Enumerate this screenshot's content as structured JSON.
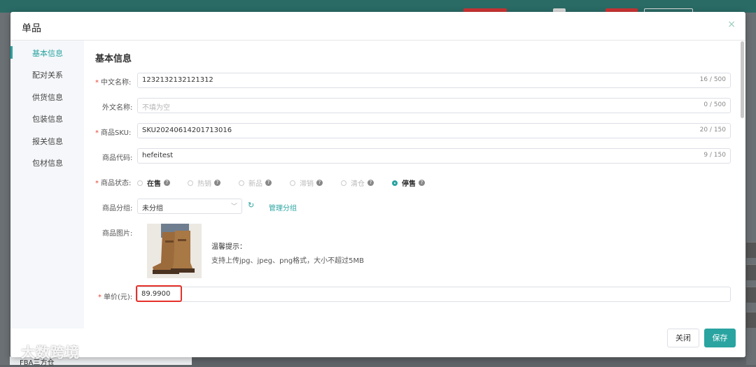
{
  "dialog": {
    "title": "单品",
    "close_icon": "×"
  },
  "sidebar": {
    "items": [
      {
        "label": "基本信息",
        "active": true
      },
      {
        "label": "配对关系",
        "active": false
      },
      {
        "label": "供货信息",
        "active": false
      },
      {
        "label": "包装信息",
        "active": false
      },
      {
        "label": "报关信息",
        "active": false
      },
      {
        "label": "包材信息",
        "active": false
      }
    ]
  },
  "section": {
    "title": "基本信息"
  },
  "form": {
    "required_mark": "*",
    "cn_name": {
      "label": "中文名称:",
      "value": "1232132132121312",
      "count": "16 / 500"
    },
    "foreign_name": {
      "label": "外文名称:",
      "placeholder": "不填为空",
      "count": "0 / 500"
    },
    "sku": {
      "label": "商品SKU:",
      "value": "SKU20240614201713016",
      "count": "20 / 150"
    },
    "code": {
      "label": "商品代码:",
      "value": "hefeitest",
      "count": "9 / 150"
    },
    "status": {
      "label": "商品状态:",
      "help_icon": "?",
      "options": [
        {
          "label": "在售",
          "checked": false,
          "enabled": true
        },
        {
          "label": "热销",
          "checked": false,
          "enabled": false
        },
        {
          "label": "新品",
          "checked": false,
          "enabled": false
        },
        {
          "label": "滞销",
          "checked": false,
          "enabled": false
        },
        {
          "label": "清仓",
          "checked": false,
          "enabled": false
        },
        {
          "label": "停售",
          "checked": true,
          "enabled": true
        }
      ]
    },
    "group": {
      "label": "商品分组:",
      "value": "未分组",
      "refresh_icon": "↻",
      "manage_label": "管理分组"
    },
    "image": {
      "label": "商品图片:",
      "tip_title": "温馨提示：",
      "tip_text": "支持上传jpg、jpeg、png格式，大小不超过5MB"
    },
    "price": {
      "label": "单价(元):",
      "value": "89.9900"
    }
  },
  "footer": {
    "close_label": "关闭",
    "save_label": "保存"
  },
  "background": {
    "tab_label": "FBA三方仓"
  },
  "watermark": "大数跨境",
  "colors": {
    "accent": "#2aa4a1",
    "required": "#e5483b",
    "highlight": "#e5312a"
  }
}
